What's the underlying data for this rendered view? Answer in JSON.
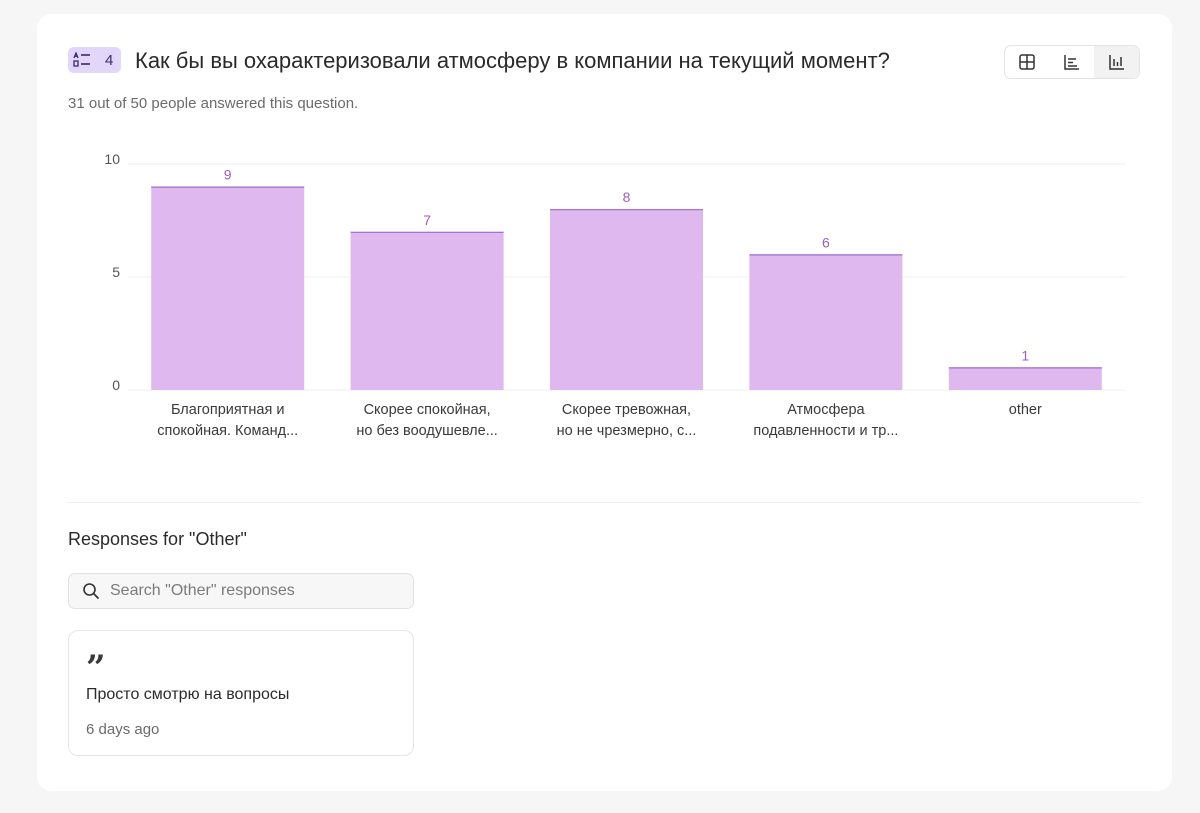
{
  "question": {
    "number": "4",
    "title": "Как бы вы охарактеризовали атмосферу в компании на текущий момент?",
    "answered_text": "31 out of 50 people answered this question."
  },
  "view_toggle": {
    "options": [
      "table-view-icon",
      "horizontal-bar-icon",
      "vertical-bar-icon"
    ],
    "active": "vertical-bar-icon"
  },
  "colors": {
    "bar_fill": "#dfb8ef",
    "bar_top": "#a06ac8",
    "bar_label": "#9a5fc2",
    "grid": "#efefef",
    "badge_bg": "#e2d6fb"
  },
  "chart_data": {
    "type": "bar",
    "categories": [
      [
        "Благоприятная и",
        "спокойная. Команд..."
      ],
      [
        "Скорее спокойная,",
        "но без воодушевле..."
      ],
      [
        "Скорее тревожная,",
        "но не чрезмерно, с..."
      ],
      [
        "Атмосфера",
        "подавленности и тр..."
      ],
      [
        "other"
      ]
    ],
    "values": [
      9,
      7,
      8,
      6,
      1
    ],
    "ylim": [
      0,
      10
    ],
    "yticks": [
      0,
      5,
      10
    ],
    "grid": true
  },
  "other_responses": {
    "heading": "Responses for \"Other\"",
    "search_placeholder": "Search \"Other\" responses",
    "items": [
      {
        "text": "Просто смотрю на вопросы",
        "time": "6 days ago"
      }
    ]
  }
}
